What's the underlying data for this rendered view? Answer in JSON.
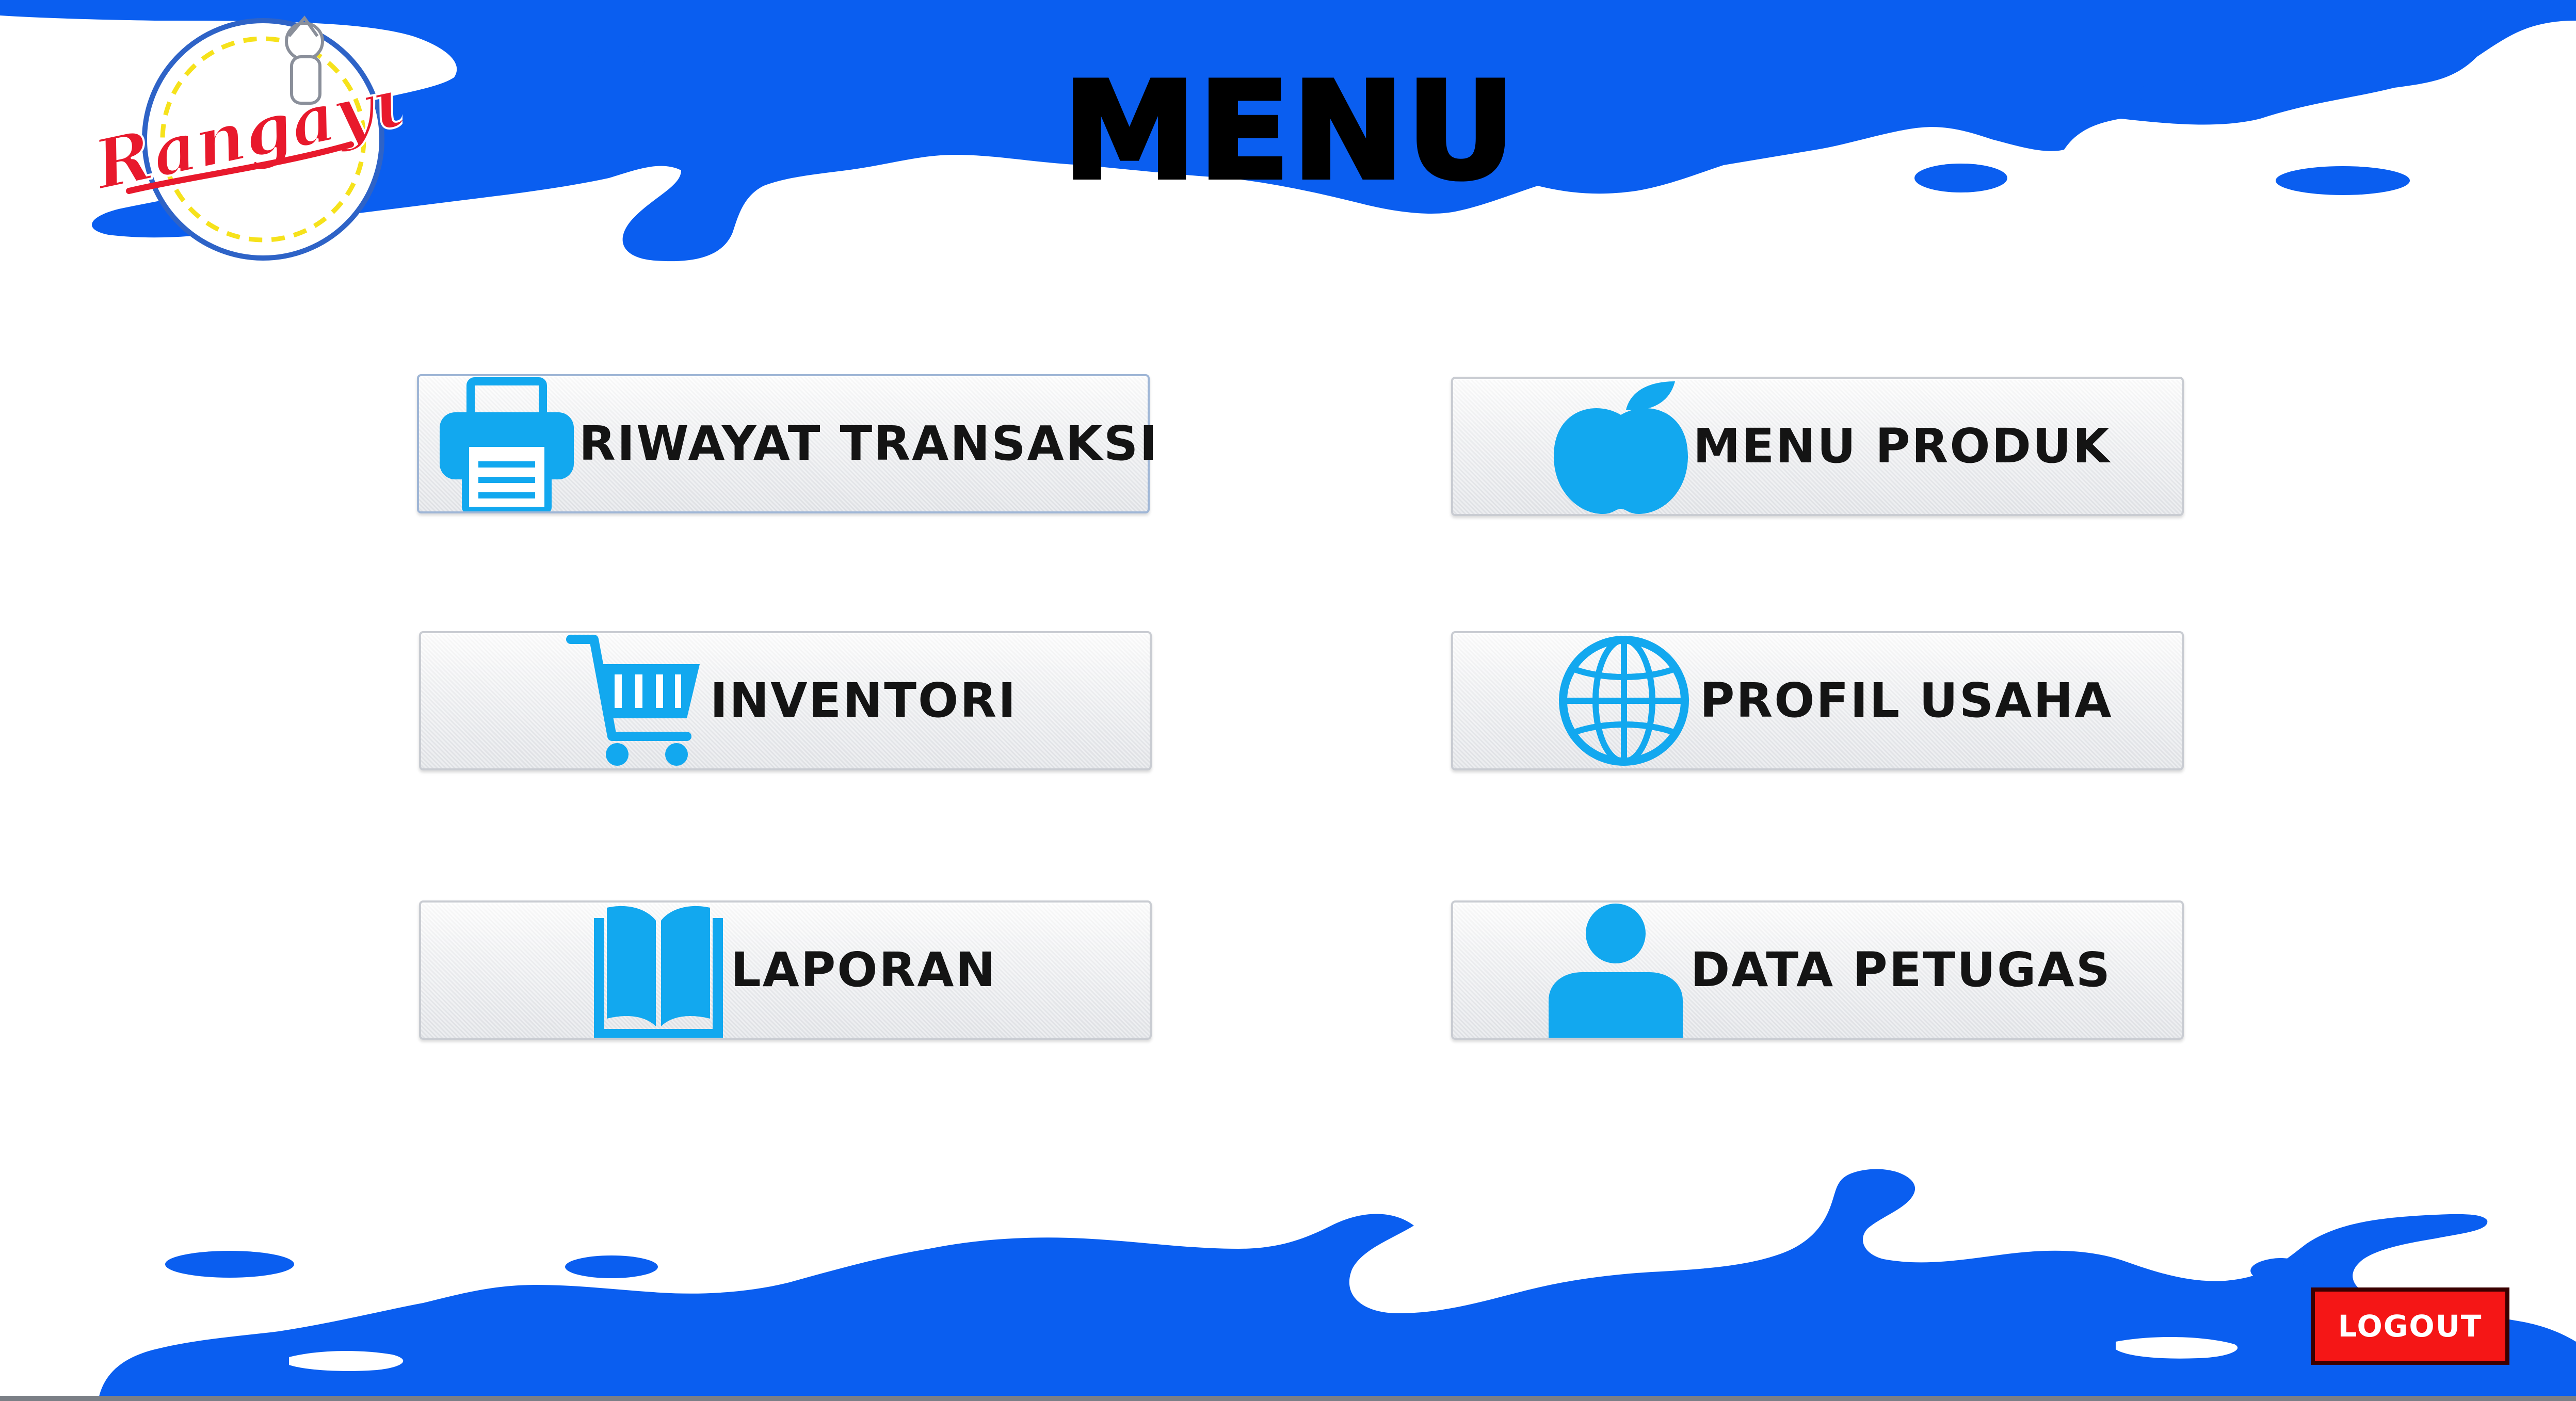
{
  "app": {
    "title": "MENU"
  },
  "colors": {
    "splash_blue": "#0a5ef0",
    "icon_blue": "#12a8ef",
    "logout_red": "#f51616",
    "logo_red": "#e8192c",
    "logo_yellow": "#f6e21b"
  },
  "logo": {
    "icon": "brand-logo",
    "text": "Rangayu"
  },
  "menu": {
    "buttons": [
      {
        "id": "riwayat-transaksi",
        "label": "RIWAYAT TRANSAKSI",
        "icon": "printer-icon",
        "active": true
      },
      {
        "id": "menu-produk",
        "label": "MENU PRODUK",
        "icon": "apple-icon",
        "active": false
      },
      {
        "id": "inventori",
        "label": "INVENTORI",
        "icon": "shopping-cart-icon",
        "active": false
      },
      {
        "id": "profil-usaha",
        "label": "PROFIL USAHA",
        "icon": "globe-icon",
        "active": false
      },
      {
        "id": "laporan",
        "label": "LAPORAN",
        "icon": "book-icon",
        "active": false
      },
      {
        "id": "data-petugas",
        "label": "DATA PETUGAS",
        "icon": "user-icon",
        "active": false
      }
    ]
  },
  "logout": {
    "label": "LOGOUT"
  }
}
